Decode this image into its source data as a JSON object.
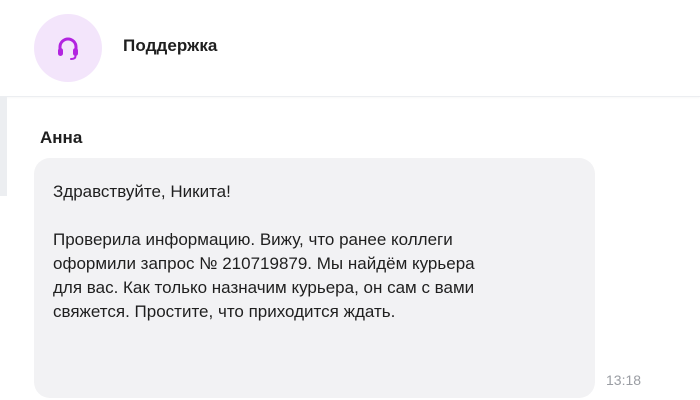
{
  "header": {
    "title": "Поддержка",
    "avatar_icon": "headset-icon",
    "accent_color": "#b224e0",
    "avatar_bg": "#f3e5fb"
  },
  "message": {
    "sender": "Анна",
    "greeting": "Здравствуйте, Никита!",
    "body_lines": [
      "Проверила информацию. Вижу, что ранее коллеги",
      "оформили запрос № 210719879. Мы найдём курьера",
      "для вас. Как только назначим курьера, он сам с вами",
      "свяжется. Простите, что приходится ждать."
    ],
    "time": "13:18"
  }
}
